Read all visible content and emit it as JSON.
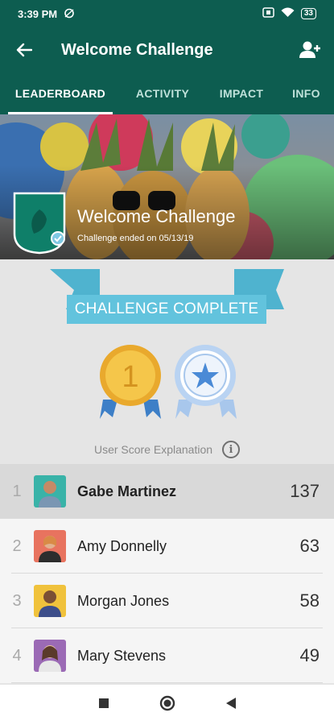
{
  "status_bar": {
    "time": "3:39 PM",
    "battery": "33"
  },
  "app_bar": {
    "title": "Welcome Challenge",
    "back_icon": "arrow-left-icon",
    "action_icon": "add-user-icon"
  },
  "tabs": [
    {
      "label": "LEADERBOARD",
      "active": true
    },
    {
      "label": "ACTIVITY",
      "active": false
    },
    {
      "label": "IMPACT",
      "active": false
    },
    {
      "label": "INFO",
      "active": false
    }
  ],
  "hero": {
    "title": "Welcome Challenge",
    "subtitle": "Challenge ended on 05/13/19"
  },
  "banner": {
    "label": "CHALLENGE COMPLETE"
  },
  "medals": [
    {
      "type": "first-place",
      "label": "1"
    },
    {
      "type": "star"
    }
  ],
  "score_explanation": {
    "label": "User Score Explanation",
    "icon": "i"
  },
  "leaderboard": [
    {
      "rank": "1",
      "name": "Gabe Martinez",
      "score": "137",
      "highlighted": true
    },
    {
      "rank": "2",
      "name": "Amy Donnelly",
      "score": "63",
      "highlighted": false
    },
    {
      "rank": "3",
      "name": "Morgan Jones",
      "score": "58",
      "highlighted": false
    },
    {
      "rank": "4",
      "name": "Mary Stevens",
      "score": "49",
      "highlighted": false
    }
  ],
  "colors": {
    "primary": "#0d5d50",
    "banner": "#62c3dd",
    "gold": "#f0b93a",
    "ribbon_blue": "#3d7fc7"
  }
}
